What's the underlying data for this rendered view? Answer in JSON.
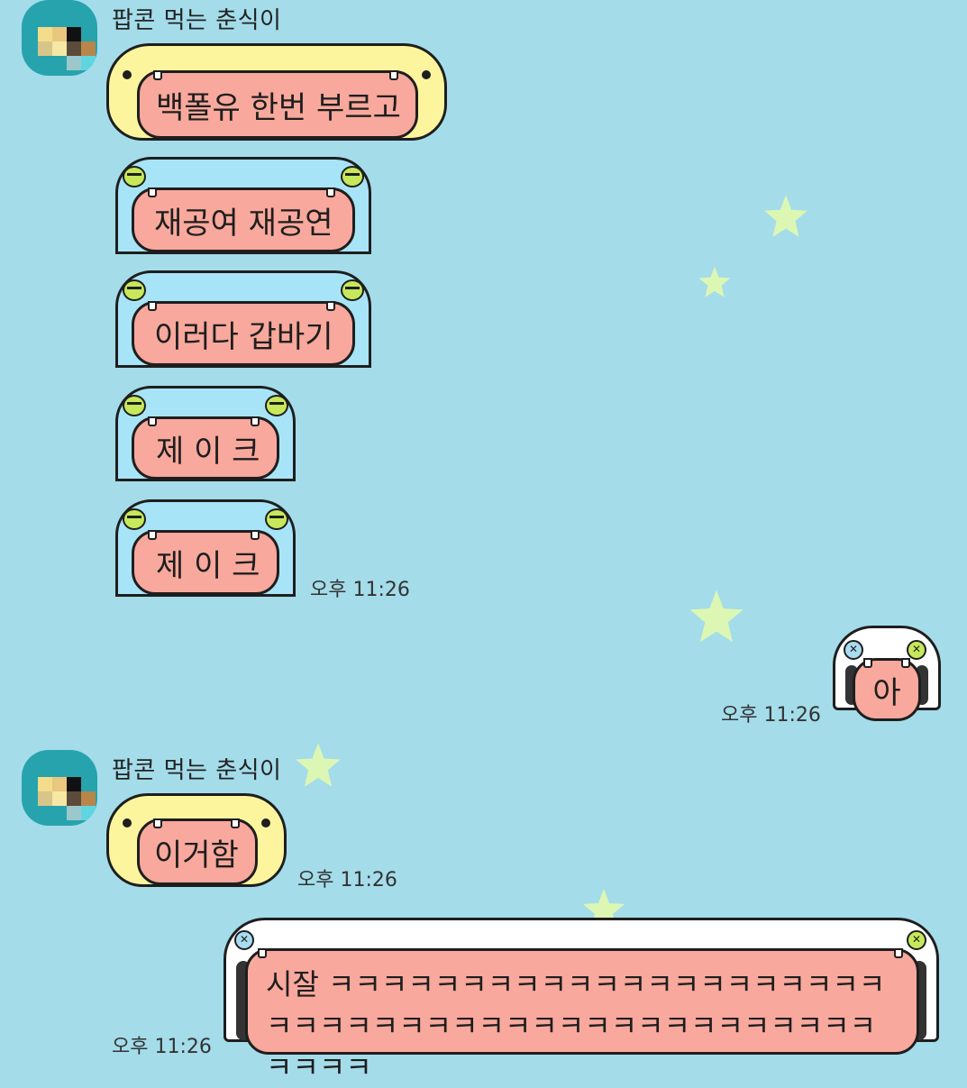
{
  "colors": {
    "background": "#a4dcea",
    "bubble_yellow": "#fdf59e",
    "bubble_blue": "#a8e4f8",
    "bubble_white": "#ffffff",
    "mouth_salmon": "#f8a89c",
    "star": "#dcf7b4"
  },
  "messages": [
    {
      "sender": "팝콘 먹는 춘식이",
      "bubbles": [
        "백폴유 한번 부르고",
        "재공여 재공연",
        "이러다 갑바기",
        "제 이 크",
        "제 이 크"
      ],
      "time": "오후 11:26"
    },
    {
      "sender": "me",
      "bubbles": [
        "아"
      ],
      "time": "오후 11:26"
    },
    {
      "sender": "팝콘 먹는 춘식이",
      "bubbles": [
        "이거함"
      ],
      "time": "오후 11:26"
    },
    {
      "sender": "me",
      "bubbles": [
        "시잘 ㅋㅋㅋㅋㅋㅋㅋㅋㅋㅋㅋㅋㅋㅋㅋㅋㅋㅋㅋㅋㅋㅋㅋㅋㅋㅋㅋㅋㅋㅋㅋㅋㅋㅋㅋㅋㅋㅋㅋㅋㅋㅋㅋㅋㅋㅋㅋㅋ"
      ],
      "time": "오후 11:26"
    }
  ]
}
